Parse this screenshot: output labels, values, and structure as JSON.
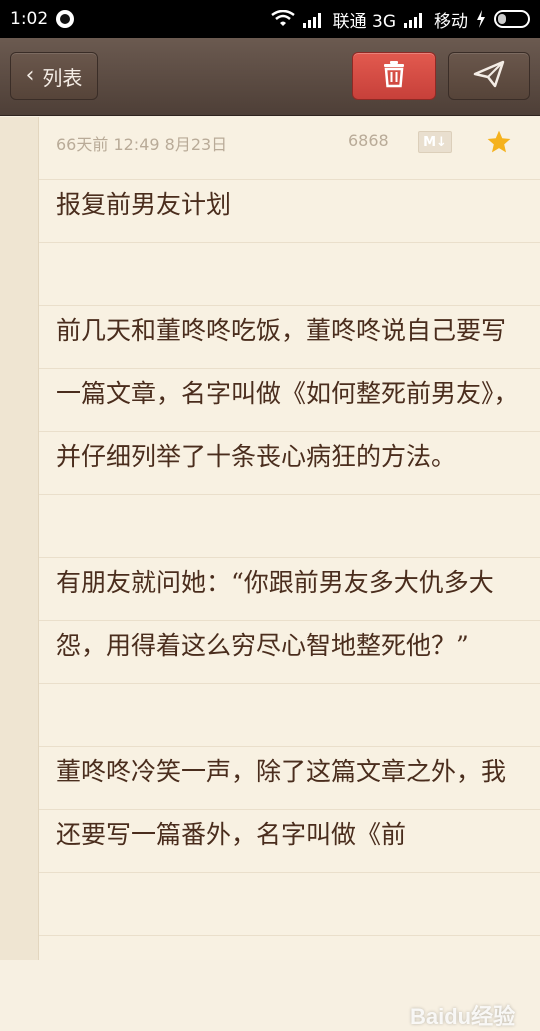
{
  "status_bar": {
    "time": "1:02",
    "carrier1": "联通 3G",
    "carrier2": "移动",
    "icons": [
      "qq-icon",
      "wifi-icon",
      "signal-icon",
      "signal-icon",
      "charge-icon",
      "battery-icon"
    ]
  },
  "header": {
    "back_label": "列表",
    "back_icon": "chevron-left-icon",
    "delete_icon": "trash-icon",
    "send_icon": "paper-plane-icon",
    "delete_color": "#d44c44"
  },
  "meta": {
    "date": "66天前  12:49  8月23日",
    "char_count": "6868",
    "markdown_badge": "M↓",
    "starred": true,
    "star_color": "#f5b21d"
  },
  "note": {
    "title": "报复前男友计划",
    "paragraphs": [
      "前几天和董咚咚吃饭，董咚咚说自己要写一篇文章，名字叫做《如何整死前男友》，并仔细列举了十条丧心病狂的方法。",
      "有朋友就问她：“你跟前男友多大仇多大怨，用得着这么穷尽心智地整死他？”",
      "董咚咚冷笑一声，除了这篇文章之外，我还要写一篇番外，名字叫做《前"
    ]
  },
  "watermark": "Baidu经验"
}
